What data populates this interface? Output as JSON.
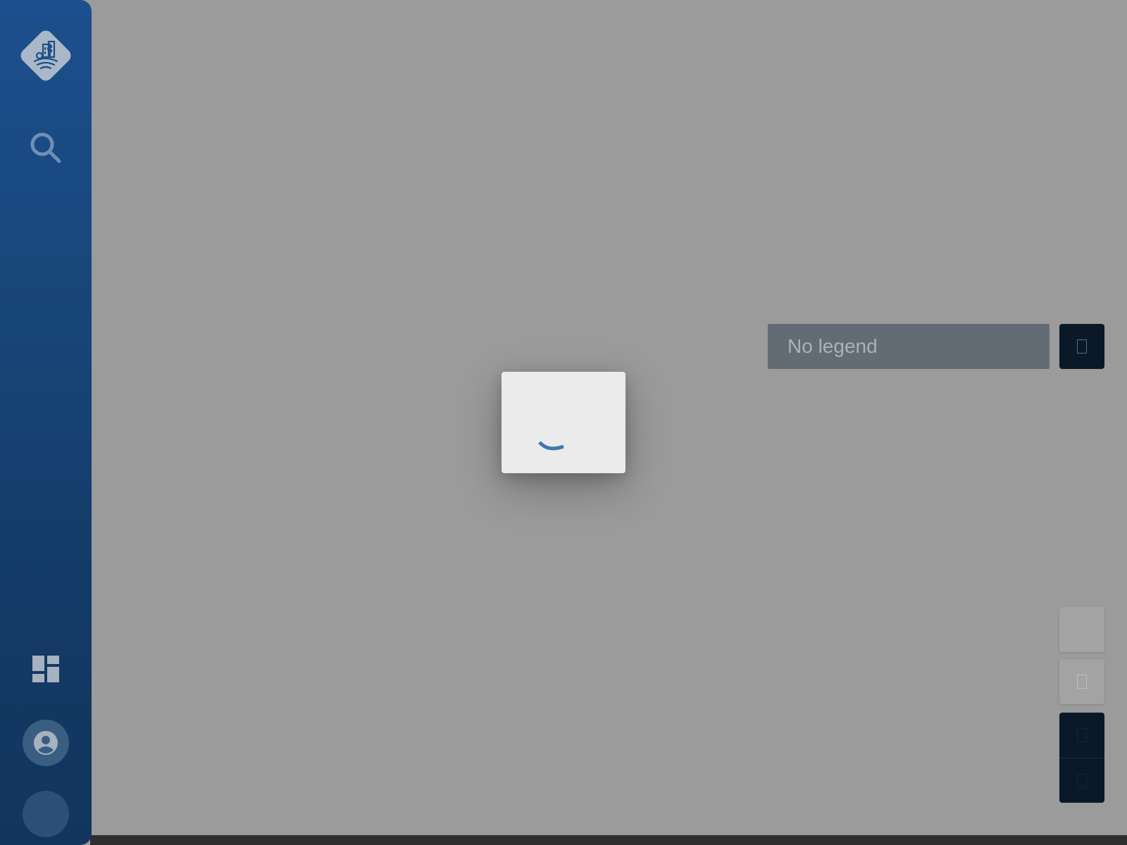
{
  "sidebar": {
    "logo_icon": "city-wifi-logo-icon",
    "search_icon": "search-icon",
    "dashboard_icon": "dashboard-icon",
    "account_icon": "account-circle-icon",
    "avatar": "avatar"
  },
  "legend": {
    "label": "No legend",
    "toggle_icon": "legend-toggle-icon"
  },
  "map_controls": [
    {
      "name": "map-control-1",
      "style": "light"
    },
    {
      "name": "map-control-2",
      "style": "light"
    },
    {
      "name": "map-control-3",
      "style": "dark"
    },
    {
      "name": "map-control-4",
      "style": "dark"
    }
  ],
  "loading": {
    "spinner_icon": "loading-spinner-icon"
  },
  "colors": {
    "sidebar_top": "#1c4f8e",
    "sidebar_bottom": "#12355e",
    "map_overlay": "#9b9b9b",
    "legend_bg": "#636c75",
    "dark_button": "#0b1827",
    "spinner": "#3f78b0"
  }
}
